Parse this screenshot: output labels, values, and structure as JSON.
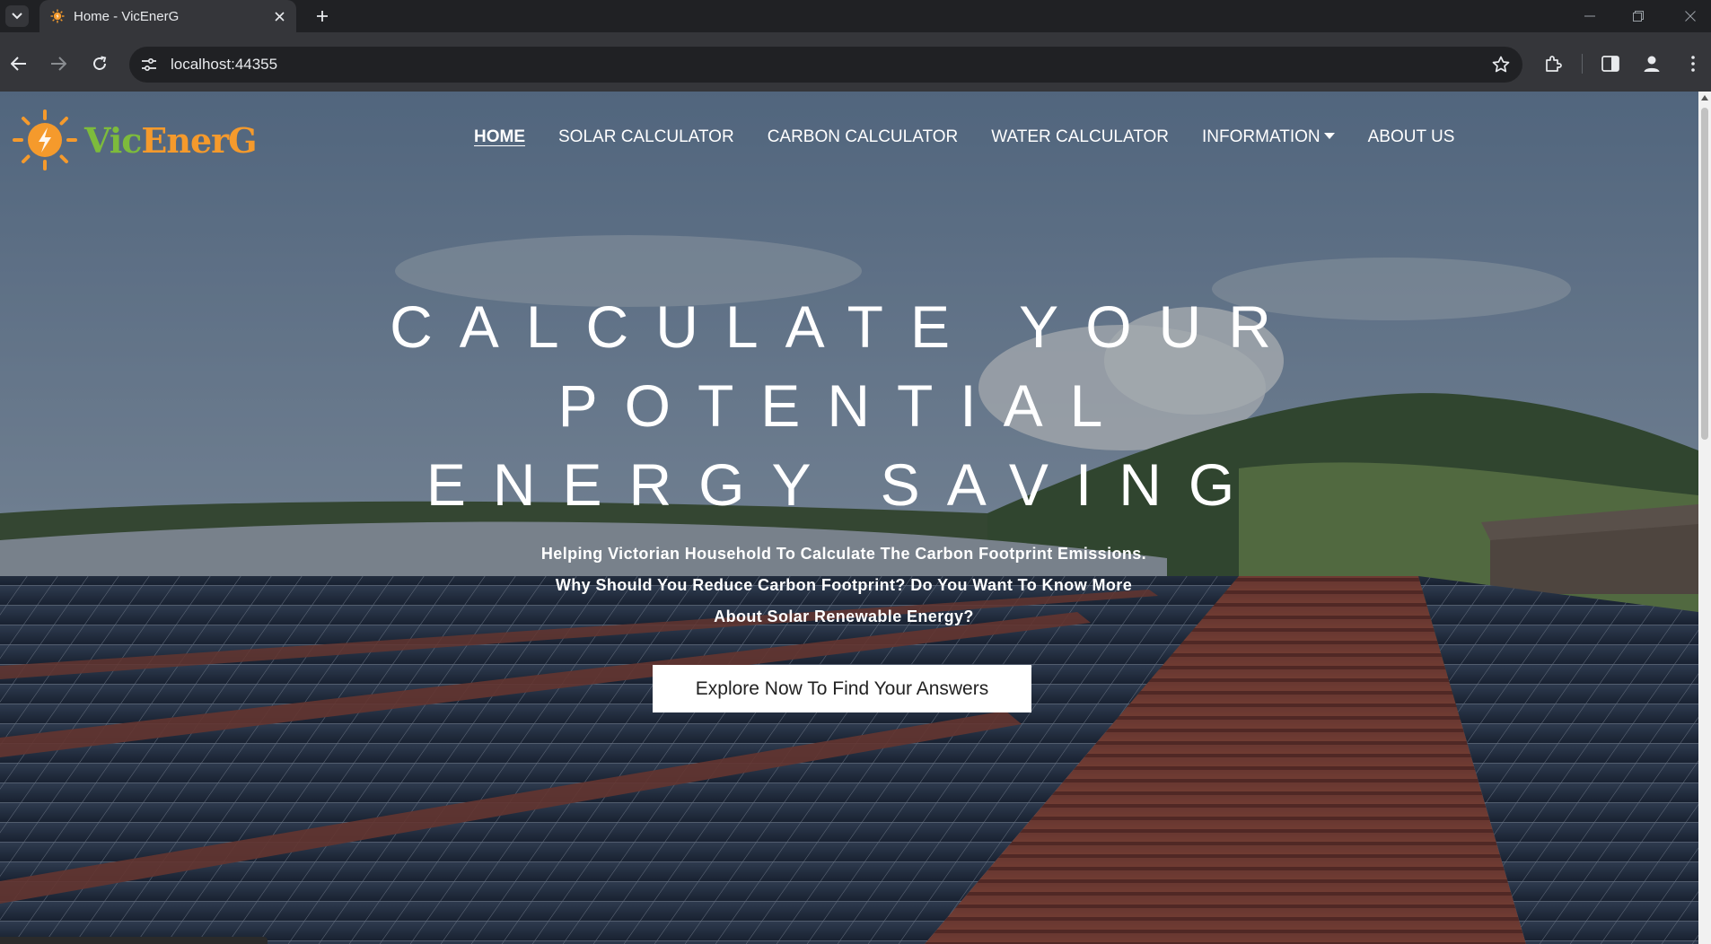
{
  "browser": {
    "tab_title": "Home - VicEnerG",
    "url": "localhost:44355"
  },
  "site": {
    "logo_vic": "Vic",
    "logo_ener": "EnerG",
    "nav": [
      {
        "label": "HOME"
      },
      {
        "label": "SOLAR CALCULATOR"
      },
      {
        "label": "CARBON CALCULATOR"
      },
      {
        "label": "WATER CALCULATOR"
      },
      {
        "label": "INFORMATION"
      },
      {
        "label": "ABOUT US"
      }
    ]
  },
  "hero": {
    "headline_lines": [
      "CALCULATE YOUR",
      "POTENTIAL",
      "ENERGY SAVING"
    ],
    "subtext": "Helping Victorian Household To Calculate The Carbon Footprint Emissions. Why Should You Reduce Carbon Footprint? Do You Want To Know More About Solar Renewable Energy?",
    "cta_label": "Explore Now To Find Your Answers"
  },
  "colors": {
    "logo_green": "#7dbb3c",
    "logo_orange": "#f59a2c",
    "chrome_dark": "#202124",
    "chrome_toolbar": "#35363a"
  },
  "icons": [
    "tab-list-icon",
    "sun-bolt-favicon-icon",
    "close-icon",
    "plus-icon",
    "minimize-icon",
    "restore-icon",
    "back-icon",
    "forward-icon",
    "reload-icon",
    "site-info-icon",
    "star-icon",
    "extensions-icon",
    "side-panel-icon",
    "profile-icon",
    "more-icon",
    "caret-down-icon"
  ]
}
